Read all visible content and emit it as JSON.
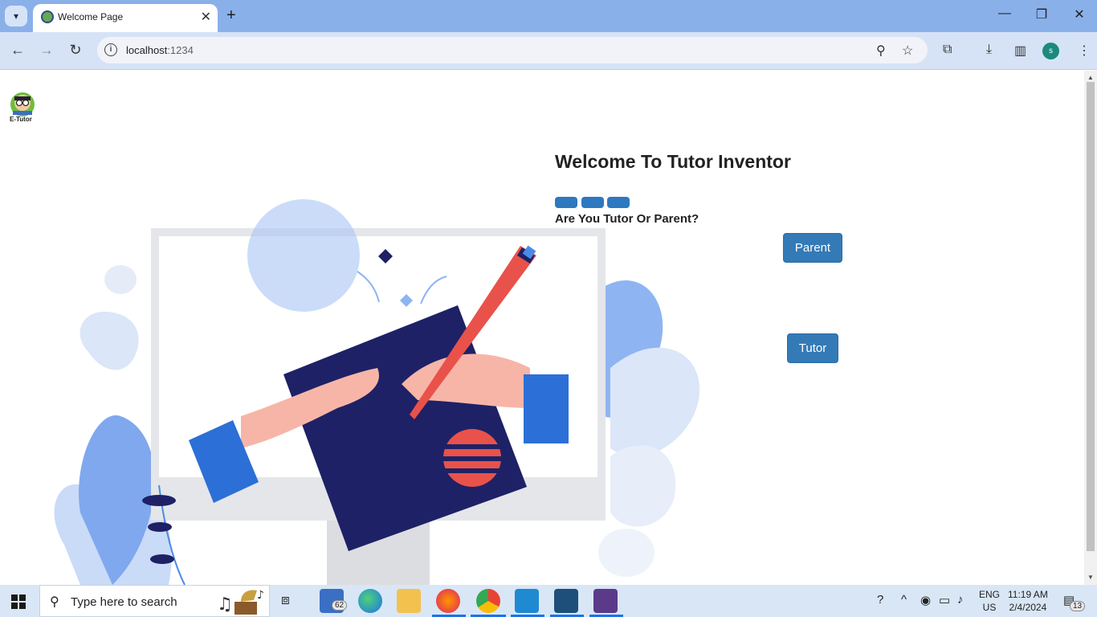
{
  "browser": {
    "tab_title": "Welcome Page",
    "tab_close": "✕",
    "new_tab": "+",
    "url_host": "localhost",
    "url_port": ":1234",
    "window_minimize": "—",
    "window_restore": "❐",
    "window_close": "✕",
    "profile_initial": "s"
  },
  "page": {
    "logo_text": "E-Tutor",
    "heading": "Welcome To Tutor Inventor",
    "question": "Are You Tutor Or Parent?",
    "parent_button": "Parent",
    "tutor_button": "Tutor"
  },
  "taskbar": {
    "search_placeholder": "Type here to search",
    "mail_badge": "62",
    "lang_top": "ENG",
    "lang_bottom": "US",
    "time": "11:19 AM",
    "date": "2/4/2024",
    "notification_count": "13"
  },
  "colors": {
    "accent": "#337ab7",
    "tabstrip": "#8ab0ea",
    "toolbar": "#d6e3f7",
    "navy": "#1e2166",
    "coral": "#e8524a"
  }
}
